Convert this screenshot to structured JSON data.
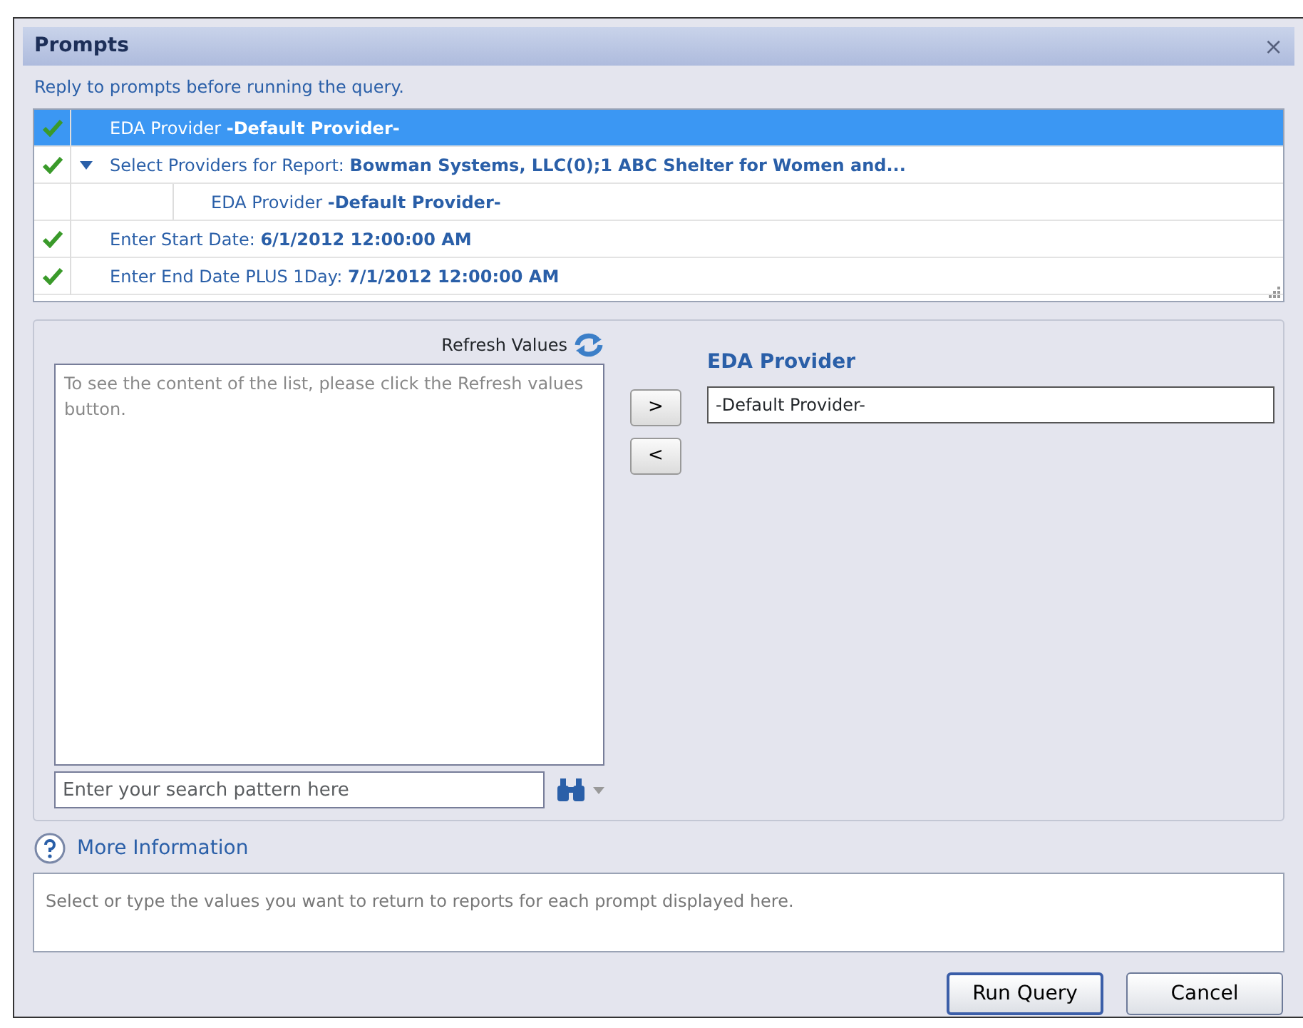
{
  "window": {
    "title": "Prompts",
    "close": "×"
  },
  "instruction": "Reply to prompts before running the query.",
  "prompts": [
    {
      "label": "EDA Provider ",
      "value": "-Default Provider-",
      "checked": true,
      "selected": true
    },
    {
      "label": "Select Providers for Report: ",
      "value": "Bowman Systems, LLC(0);1 ABC Shelter for Women and...",
      "checked": true,
      "selected": false,
      "expanded": true,
      "children": [
        {
          "label": "EDA Provider ",
          "value": "-Default Provider-",
          "selected": false
        }
      ]
    },
    {
      "label": "Enter Start Date: ",
      "value": "6/1/2012 12:00:00 AM",
      "checked": true,
      "selected": false
    },
    {
      "label": "Enter End Date PLUS 1Day: ",
      "value": "7/1/2012 12:00:00 AM",
      "checked": true,
      "selected": false
    }
  ],
  "available": {
    "refresh_label": "Refresh Values",
    "empty_message": "To see the content of the list, please click the Refresh values button.",
    "search": {
      "placeholder": "Enter your search pattern here"
    }
  },
  "move_buttons": [
    ">",
    "<"
  ],
  "selected_values": {
    "title": "EDA Provider",
    "values": [
      "-Default Provider-"
    ]
  },
  "more_information": {
    "label": "More Information",
    "text": "Select or type the values you want to return to reports for each prompt displayed here."
  },
  "buttons": [
    "Run Query",
    "Cancel"
  ]
}
